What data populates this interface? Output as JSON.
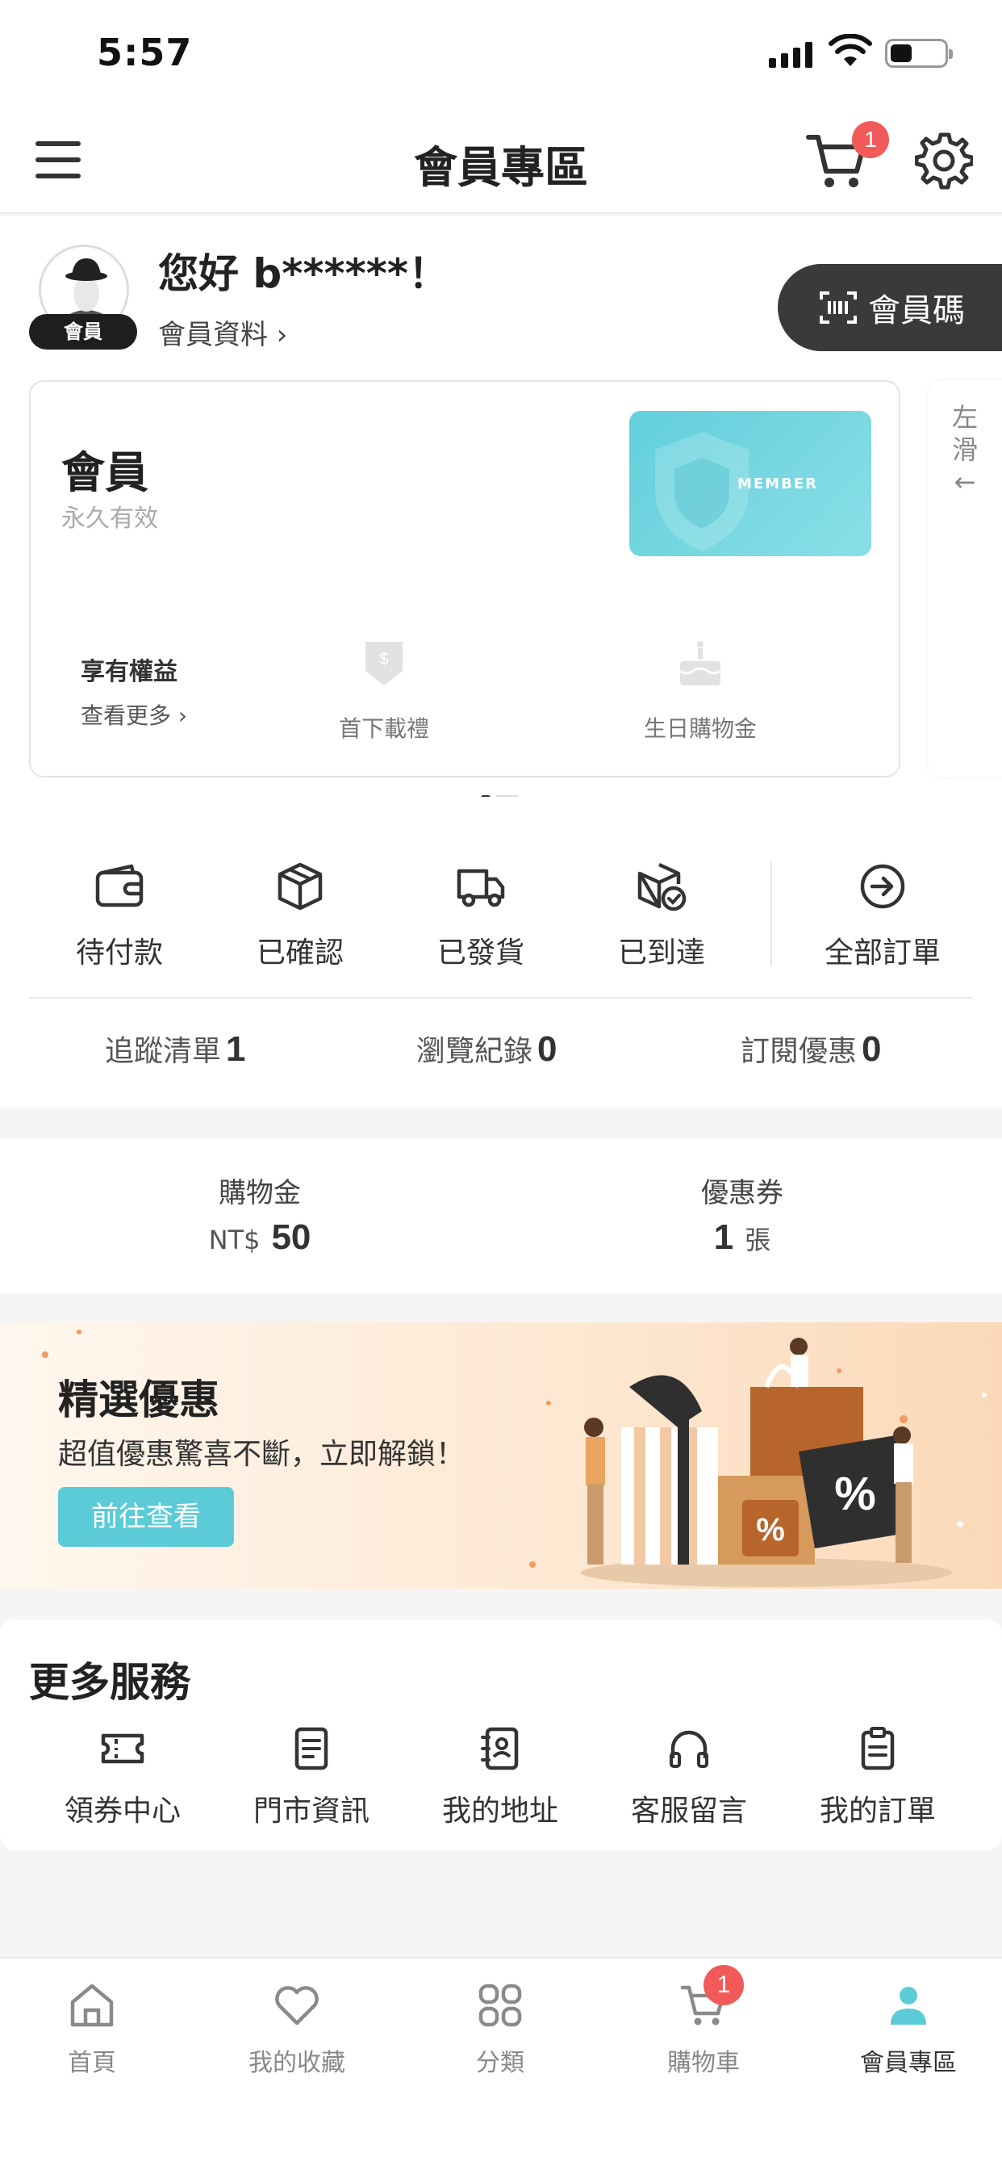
{
  "status_bar": {
    "time": "5:57"
  },
  "header": {
    "title": "會員專區",
    "cart_count": "1"
  },
  "profile": {
    "avatar_tag": "會員",
    "greeting": "您好 b******！",
    "profile_link": "會員資料 ›",
    "member_code_label": "會員碼"
  },
  "member_card": {
    "level": "會員",
    "validity": "永久有效",
    "card_text": "MEMBER",
    "benefits_title": "享有權益",
    "benefits_more": "查看更多 ›",
    "perks": [
      {
        "label": "首下載禮",
        "icon": "coupon-icon"
      },
      {
        "label": "生日購物金",
        "icon": "birthday-cake-icon"
      }
    ],
    "swipe_hint": "左滑←"
  },
  "orders": {
    "items": [
      {
        "label": "待付款",
        "icon": "wallet-icon"
      },
      {
        "label": "已確認",
        "icon": "box-icon"
      },
      {
        "label": "已發貨",
        "icon": "truck-icon"
      },
      {
        "label": "已到達",
        "icon": "box-check-icon"
      }
    ],
    "all_orders": "全部訂單"
  },
  "stats": [
    {
      "label": "追蹤清單",
      "value": "1"
    },
    {
      "label": "瀏覽紀錄",
      "value": "0"
    },
    {
      "label": "訂閱優惠",
      "value": "0"
    }
  ],
  "wallet": {
    "credit_label": "購物金",
    "credit_currency": "NT$",
    "credit_value": "50",
    "coupon_label": "優惠券",
    "coupon_value": "1",
    "coupon_unit": "張"
  },
  "promo": {
    "title": "精選優惠",
    "subtitle": "超值優惠驚喜不斷，立即解鎖！",
    "button": "前往查看",
    "badge_symbol": "%"
  },
  "services": {
    "title": "更多服務",
    "items": [
      {
        "label": "領券中心",
        "icon": "ticket-icon"
      },
      {
        "label": "門市資訊",
        "icon": "document-icon"
      },
      {
        "label": "我的地址",
        "icon": "address-book-icon"
      },
      {
        "label": "客服留言",
        "icon": "headphones-icon"
      },
      {
        "label": "我的訂單",
        "icon": "clipboard-icon"
      }
    ]
  },
  "tabbar": {
    "items": [
      {
        "label": "首頁",
        "icon": "home-icon"
      },
      {
        "label": "我的收藏",
        "icon": "heart-icon"
      },
      {
        "label": "分類",
        "icon": "category-icon"
      },
      {
        "label": "購物車",
        "icon": "cart-icon"
      },
      {
        "label": "會員專區",
        "icon": "user-icon"
      }
    ],
    "cart_count": "1",
    "active": "會員專區"
  },
  "colors": {
    "accent": "#5ccbd8",
    "badge": "#f25a5a",
    "dark_button": "#3a3a3a",
    "tab_active_icon": "#5ccbd8"
  }
}
